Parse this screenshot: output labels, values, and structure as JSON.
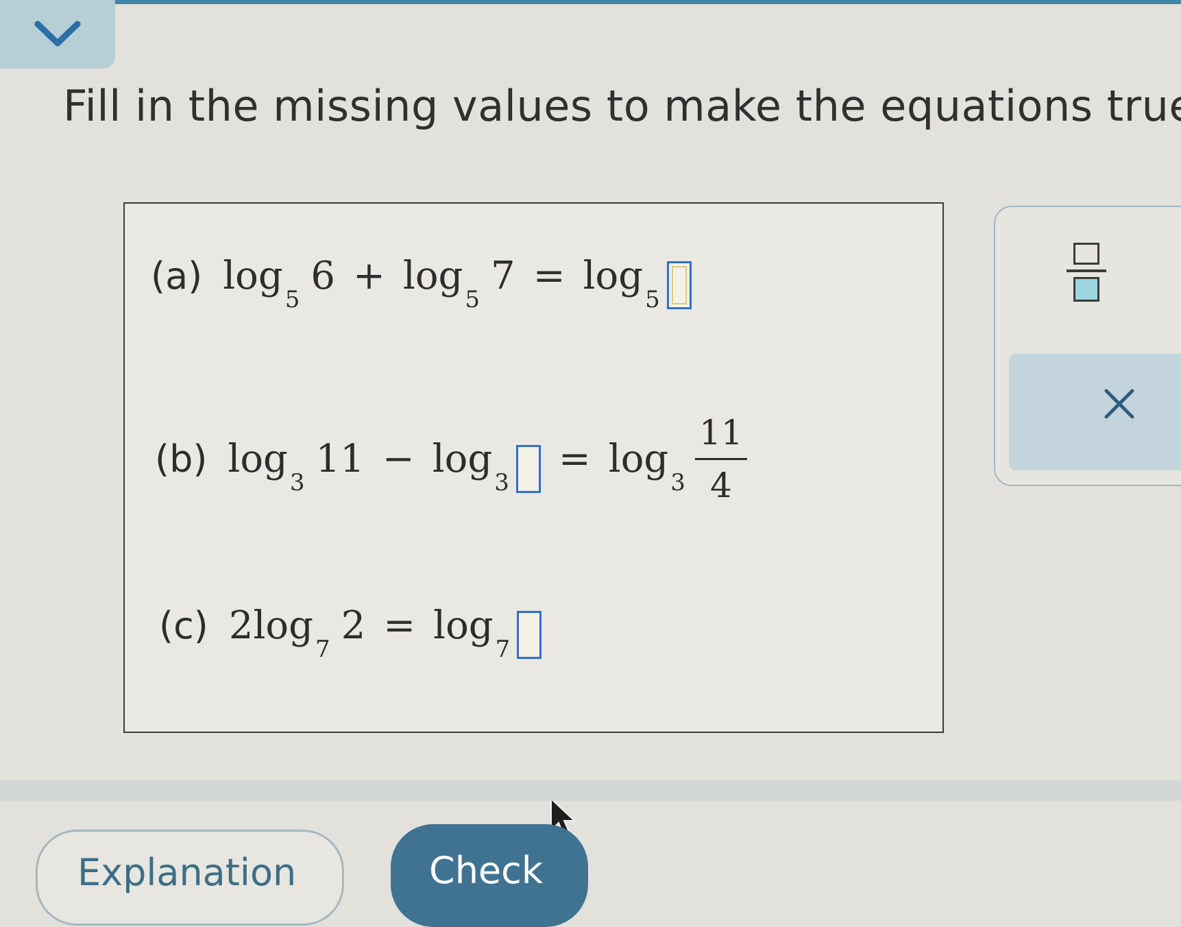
{
  "header": {
    "collapse_icon": "chevron-down-icon"
  },
  "instruction": "Fill in the missing values to make the equations true.",
  "parts": {
    "a": {
      "label": "(a)",
      "log": "log",
      "base": "5",
      "arg1": "6",
      "plus": "+",
      "arg2": "7",
      "equals": "=",
      "answer": ""
    },
    "b": {
      "label": "(b)",
      "log": "log",
      "base": "3",
      "arg1": "11",
      "minus": "−",
      "equals": "=",
      "answer": "",
      "frac_num": "11",
      "frac_den": "4"
    },
    "c": {
      "label": "(c)",
      "coef": "2",
      "log": "log",
      "base": "7",
      "arg1": "2",
      "equals": "=",
      "answer": ""
    }
  },
  "toolbar": {
    "fraction_icon": "fraction-icon",
    "clear_icon": "close-icon"
  },
  "buttons": {
    "explanation": "Explanation",
    "check": "Check"
  },
  "colors": {
    "accent": "#3f7391",
    "answer_box_border": "#2f6fd0",
    "tab_background": "#b7ced6"
  }
}
